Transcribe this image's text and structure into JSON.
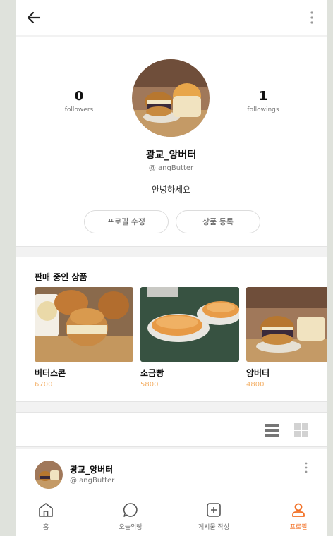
{
  "header": {
    "back_icon": "arrow-left-icon",
    "menu_icon": "vertical-dots-icon"
  },
  "profile": {
    "followers_count": "0",
    "followers_label": "followers",
    "followings_count": "1",
    "followings_label": "followings",
    "name": "광교_앙버터",
    "handle": "@ angButter",
    "bio": "안녕하세요",
    "edit_button": "프로필 수정",
    "add_product_button": "상품 등록"
  },
  "products": {
    "title": "판매 중인 상품",
    "items": [
      {
        "name": "버터스콘",
        "price": "6700"
      },
      {
        "name": "소금빵",
        "price": "5800"
      },
      {
        "name": "앙버터",
        "price": "4800"
      }
    ]
  },
  "view_toggle": {
    "list_icon": "list-view-icon",
    "grid_icon": "grid-view-icon",
    "selected": "list"
  },
  "post": {
    "name": "광교_앙버터",
    "handle": "@ angButter"
  },
  "tabbar": {
    "items": [
      {
        "label": "홈",
        "icon": "home-icon"
      },
      {
        "label": "오늘의빵",
        "icon": "chat-icon"
      },
      {
        "label": "게시물 작성",
        "icon": "plus-square-icon"
      },
      {
        "label": "프로필",
        "icon": "user-icon",
        "active": true
      }
    ]
  },
  "colors": {
    "accent": "#f26e22",
    "price": "#f4b26b"
  }
}
